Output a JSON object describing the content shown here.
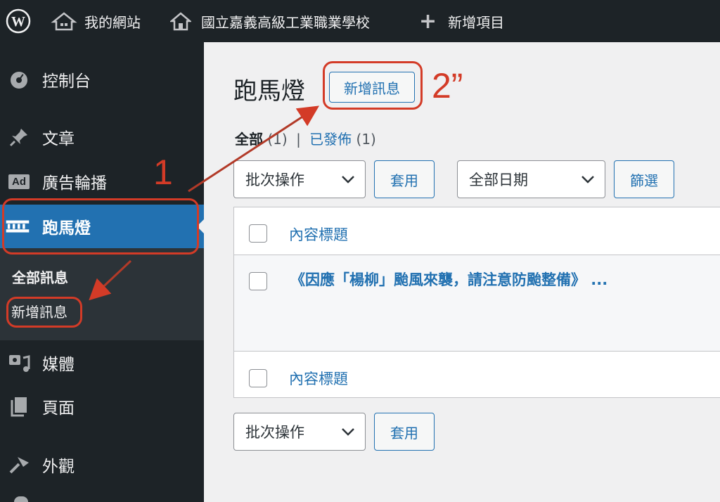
{
  "adminbar": {
    "wp_logo": "wordpress-logo",
    "site_name": "我的網站",
    "school_name": "國立嘉義高級工業職業學校",
    "new_item": "新增項目"
  },
  "sidebar": {
    "items": [
      {
        "label": "控制台",
        "icon": "dashboard-icon"
      },
      {
        "label": "文章",
        "icon": "pin-icon"
      },
      {
        "label": "廣告輪播",
        "icon": "ad-icon",
        "icon_text": "Ad"
      },
      {
        "label": "跑馬燈",
        "icon": "marquee-icon"
      },
      {
        "label": "媒體",
        "icon": "media-icon"
      },
      {
        "label": "頁面",
        "icon": "page-icon"
      },
      {
        "label": "外觀",
        "icon": "appearance-icon"
      }
    ],
    "submenu": [
      "全部訊息",
      "新增訊息"
    ]
  },
  "page": {
    "title": "跑馬燈",
    "add_new": "新增訊息",
    "filters": {
      "all": "全部",
      "all_count": "(1)",
      "separator": "|",
      "published": "已發佈",
      "published_count": "(1)"
    },
    "bulk_action": "批次操作",
    "apply": "套用",
    "all_dates": "全部日期",
    "filter": "篩選",
    "table": {
      "header": "內容標題",
      "rows": [
        {
          "title": "《因應「楊柳」颱風來襲，請注意防颱整備》 ..."
        }
      ],
      "footer": "內容標題"
    }
  },
  "annotations": {
    "step1": "1",
    "step2": "2”",
    "color": "#d33b27"
  },
  "colors": {
    "admin_bg": "#1d2327",
    "accent": "#2271b1",
    "content_bg": "#f0f0f1"
  }
}
